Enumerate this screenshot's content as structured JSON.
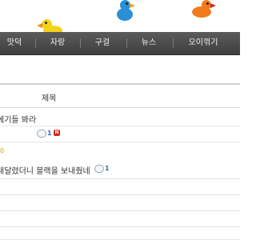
{
  "nav": {
    "items": [
      {
        "label": "맛덕"
      },
      {
        "label": "자랑"
      },
      {
        "label": "구걸"
      },
      {
        "label": "뉴스"
      },
      {
        "label": "오이꺾기"
      }
    ]
  },
  "table": {
    "header_title": "제목",
    "rows": [
      {
        "title": "에기들 봐라",
        "comments": "1",
        "new_badge": "N"
      },
      {
        "title": "",
        "mark": "0"
      },
      {
        "title": "내달렸더니 블랙을 보내줬네",
        "comments": "1"
      }
    ]
  },
  "colors": {
    "nav_bg": "#4a4a4a",
    "nav_text": "#f2f2f2",
    "comment_count": "#2a6cb5",
    "new_badge": "#d9251d"
  }
}
